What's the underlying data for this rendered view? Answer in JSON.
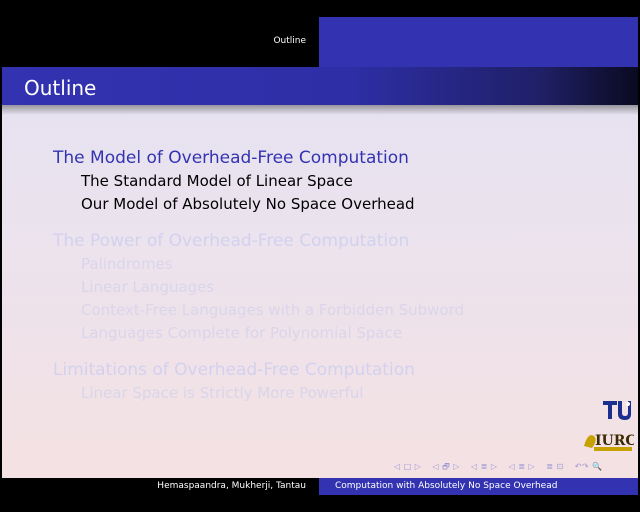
{
  "header": {
    "section": "Outline"
  },
  "frame": {
    "title": "Outline"
  },
  "toc": {
    "sections": [
      {
        "title": "The Model of Overhead-Free Computation",
        "subsections": [
          "The Standard Model of Linear Space",
          "Our Model of Absolutely No Space Overhead"
        ]
      },
      {
        "title": "The Power of Overhead-Free Computation",
        "subsections": [
          "Palindromes",
          "Linear Languages",
          "Context-Free Languages with a Forbidden Subword",
          "Languages Complete for Polynomial Space"
        ]
      },
      {
        "title": "Limitations of Overhead-Free Computation",
        "subsections": [
          "Linear Space is Strictly More Powerful"
        ]
      }
    ]
  },
  "logos": {
    "tu": "TU",
    "iurcs": "IURCS"
  },
  "footer": {
    "authors": "Hemaspaandra, Mukherji, Tantau",
    "title": "Computation with Absolutely No Space Overhead"
  },
  "nav": {
    "frame": "◁ □ ▷",
    "subsection": "◁ 🗗 ▷",
    "section": "◁ ≣ ▷",
    "subsection2": "◁ ≣ ▷",
    "doc": "≣ ⊡",
    "search": "↶↷ 🔍"
  },
  "colors": {
    "accent": "#3333b2",
    "faded_text": "#d3d1ee"
  }
}
